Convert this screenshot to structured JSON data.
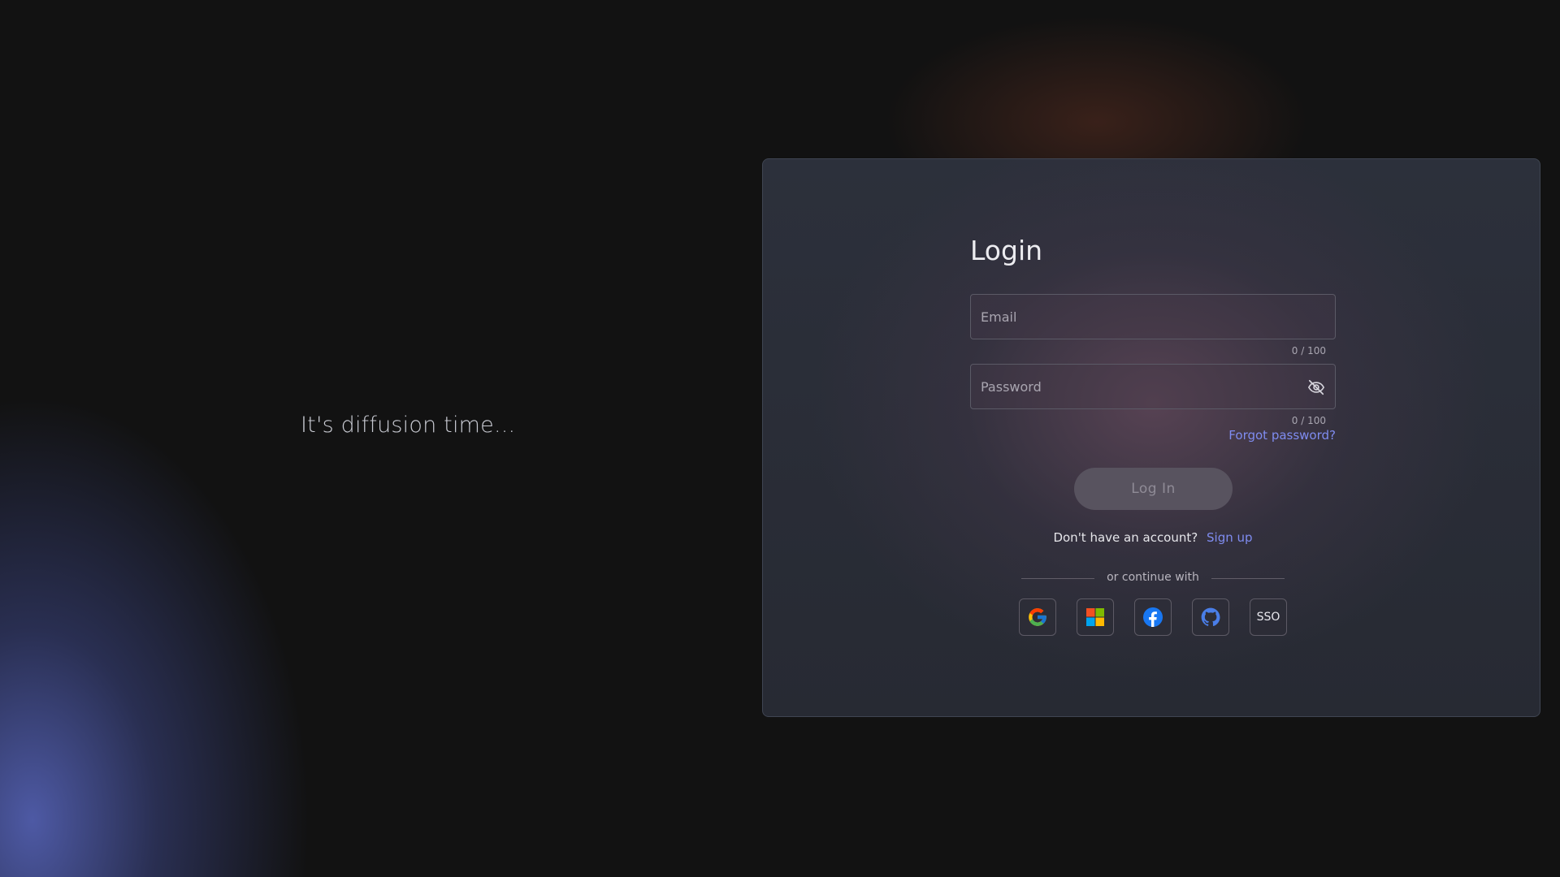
{
  "left_panel": {
    "tagline": "It's diffusion time..."
  },
  "login": {
    "title": "Login",
    "email": {
      "placeholder": "Email",
      "value": "",
      "counter": "0 / 100"
    },
    "password": {
      "placeholder": "Password",
      "value": "",
      "counter": "0 / 100",
      "visibility_icon": "eye-off-icon"
    },
    "forgot_password": "Forgot password?",
    "login_button": "Log In",
    "signup_prompt": "Don't have an account?",
    "signup_link": "Sign up",
    "divider_text": "or continue with",
    "social": [
      {
        "icon": "google-icon"
      },
      {
        "icon": "microsoft-icon"
      },
      {
        "icon": "facebook-icon"
      },
      {
        "icon": "github-icon"
      },
      {
        "label": "SSO"
      }
    ]
  },
  "colors": {
    "link": "#7f8cf0",
    "button_bg": "#58535f",
    "card_bg": "#2c303b",
    "page_bg": "#121212",
    "glow_blue": "#5866be"
  }
}
